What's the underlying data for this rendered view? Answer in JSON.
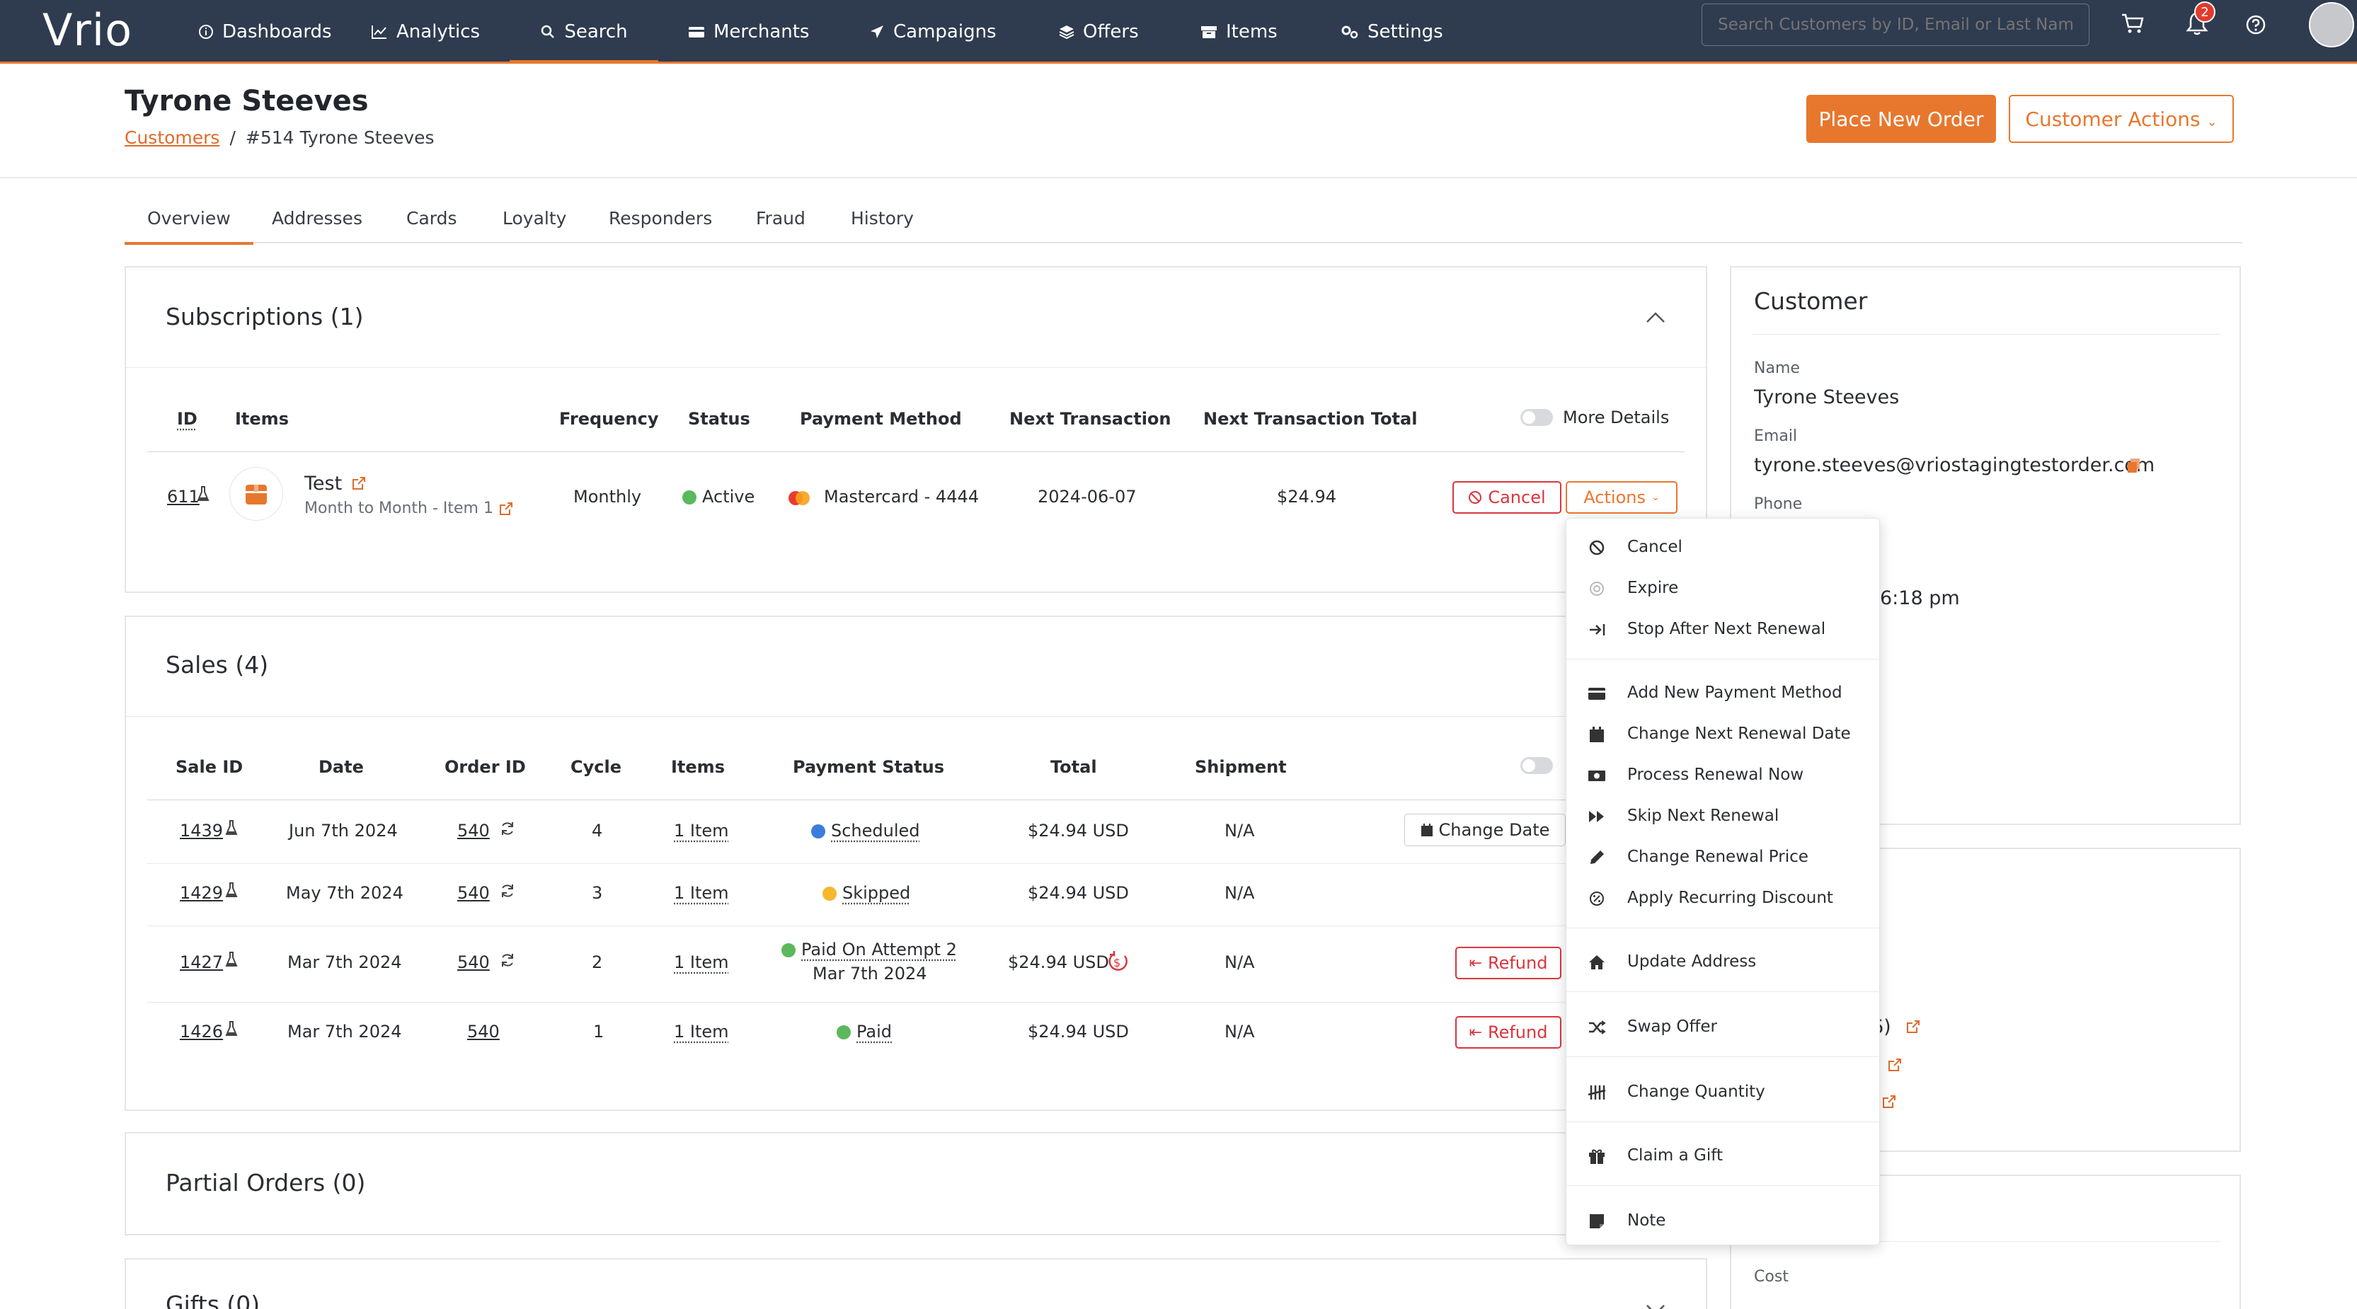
{
  "nav": {
    "logo": "Vrio",
    "items": [
      {
        "label": "Dashboards"
      },
      {
        "label": "Analytics"
      },
      {
        "label": "Search"
      },
      {
        "label": "Merchants"
      },
      {
        "label": "Campaigns"
      },
      {
        "label": "Offers"
      },
      {
        "label": "Items"
      },
      {
        "label": "Settings"
      }
    ],
    "search_placeholder": "Search Customers by ID, Email or Last Name",
    "notification_count": "2"
  },
  "header": {
    "title": "Tyrone Steeves",
    "breadcrumb_link": "Customers",
    "breadcrumb_sep": "/",
    "breadcrumb_current": "#514 Tyrone Steeves",
    "place_order": "Place New Order",
    "customer_actions": "Customer Actions"
  },
  "tabs": [
    "Overview",
    "Addresses",
    "Cards",
    "Loyalty",
    "Responders",
    "Fraud",
    "History"
  ],
  "subscriptions": {
    "title": "Subscriptions (1)",
    "headers": {
      "id": "ID",
      "items": "Items",
      "frequency": "Frequency",
      "status": "Status",
      "payment": "Payment Method",
      "next_tx": "Next Transaction",
      "next_total": "Next Transaction Total"
    },
    "more_details": "More Details",
    "row": {
      "id": "611",
      "item_name": "Test",
      "item_sub": "Month to Month - Item 1",
      "frequency": "Monthly",
      "status": "Active",
      "payment": "Mastercard - 4444",
      "next_tx": "2024-06-07",
      "next_total": "$24.94",
      "cancel": "Cancel",
      "actions": "Actions"
    }
  },
  "sales": {
    "title": "Sales (4)",
    "headers": {
      "sale_id": "Sale ID",
      "date": "Date",
      "order_id": "Order ID",
      "cycle": "Cycle",
      "items": "Items",
      "payment_status": "Payment Status",
      "total": "Total",
      "shipment": "Shipment"
    },
    "rows": [
      {
        "sale_id": "1439",
        "date": "Jun 7th 2024",
        "order_id": "540",
        "cycle": "4",
        "items": "1 Item",
        "status": "Scheduled",
        "status_color": "#3b7ddd",
        "total": "$24.94 USD",
        "shipment": "N/A",
        "action": "Change Date"
      },
      {
        "sale_id": "1429",
        "date": "May 7th 2024",
        "order_id": "540",
        "cycle": "3",
        "items": "1 Item",
        "status": "Skipped",
        "status_color": "#f5b82e",
        "total": "$24.94 USD",
        "shipment": "N/A"
      },
      {
        "sale_id": "1427",
        "date": "Mar 7th 2024",
        "order_id": "540",
        "cycle": "2",
        "items": "1 Item",
        "status": "Paid On Attempt 2",
        "status_sub": "Mar 7th 2024",
        "status_color": "#5cb85c",
        "total": "$24.94 USD",
        "shipment": "N/A",
        "action": "Refund"
      },
      {
        "sale_id": "1426",
        "date": "Mar 7th 2024",
        "order_id": "540",
        "cycle": "1",
        "items": "1 Item",
        "status": "Paid",
        "status_color": "#5cb85c",
        "total": "$24.94 USD",
        "shipment": "N/A",
        "action": "Refund"
      }
    ]
  },
  "partial_orders": {
    "title": "Partial Orders (0)"
  },
  "gifts": {
    "title": "Gifts (0)"
  },
  "customer": {
    "title": "Customer",
    "name_label": "Name",
    "name": "Tyrone Steeves",
    "email_label": "Email",
    "email": "tyrone.steeves@vriostagingtestorder.com",
    "phone_label": "Phone",
    "time_partial": "6:18 pm",
    "paren_partial": "6)",
    "cost_label": "Cost"
  },
  "dropdown": [
    {
      "label": "Cancel",
      "icon": "ban-icon"
    },
    {
      "label": "Expire",
      "icon": "circle-dot-icon"
    },
    {
      "label": "Stop After Next Renewal",
      "icon": "arrow-to-line-icon"
    },
    {
      "label": "Add New Payment Method",
      "icon": "credit-card-icon"
    },
    {
      "label": "Change Next Renewal Date",
      "icon": "calendar-icon"
    },
    {
      "label": "Process Renewal Now",
      "icon": "money-icon"
    },
    {
      "label": "Skip Next Renewal",
      "icon": "forward-icon"
    },
    {
      "label": "Change Renewal Price",
      "icon": "pencil-icon"
    },
    {
      "label": "Apply Recurring Discount",
      "icon": "percent-icon"
    },
    {
      "label": "Update Address",
      "icon": "home-icon"
    },
    {
      "label": "Swap Offer",
      "icon": "shuffle-icon"
    },
    {
      "label": "Change Quantity",
      "icon": "tally-icon"
    },
    {
      "label": "Claim a Gift",
      "icon": "gift-icon"
    },
    {
      "label": "Note",
      "icon": "note-icon"
    }
  ]
}
